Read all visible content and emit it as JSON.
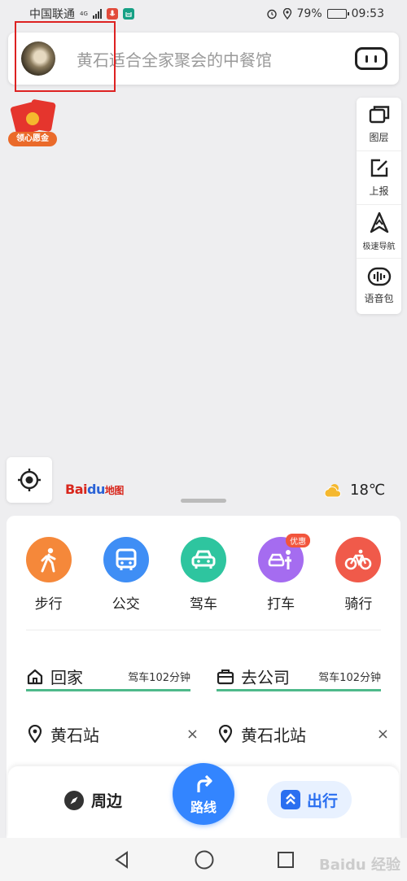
{
  "status_bar": {
    "carrier": "中国联通",
    "network": "4G",
    "battery": "79%",
    "battery_level": 0.79,
    "time": "09:53"
  },
  "search": {
    "placeholder": "黄石适合全家聚会的中餐馆"
  },
  "promo_badge": {
    "label": "领心愿金"
  },
  "side_tools": [
    {
      "label": "图层",
      "icon": "layers-icon"
    },
    {
      "label": "上报",
      "icon": "edit-icon"
    },
    {
      "label": "极速导航",
      "icon": "navigation-icon"
    },
    {
      "label": "语音包",
      "icon": "voice-pack-icon"
    }
  ],
  "map": {
    "logo_bai": "Bai",
    "logo_du": "du",
    "logo_map": "地图",
    "weather_temp": "18℃"
  },
  "travel_modes": [
    {
      "label": "步行",
      "color": "#f5883a",
      "icon": "walk-icon"
    },
    {
      "label": "公交",
      "color": "#3f8ef5",
      "icon": "bus-icon"
    },
    {
      "label": "驾车",
      "color": "#2ec59f",
      "icon": "car-icon"
    },
    {
      "label": "打车",
      "color": "#a56cf0",
      "icon": "taxi-icon",
      "badge": "优惠"
    },
    {
      "label": "骑行",
      "color": "#f05a4a",
      "icon": "bike-icon"
    }
  ],
  "shortcuts": {
    "home": {
      "label": "回家",
      "sub": "驾车102分钟"
    },
    "company": {
      "label": "去公司",
      "sub": "驾车102分钟"
    }
  },
  "recent": [
    {
      "label": "黄石站",
      "close": "×"
    },
    {
      "label": "黄石北站",
      "close": "×"
    }
  ],
  "bottom_bar": {
    "nearby": "周边",
    "route": "路线",
    "travel": "出行"
  },
  "watermark": "Baidu 经验"
}
